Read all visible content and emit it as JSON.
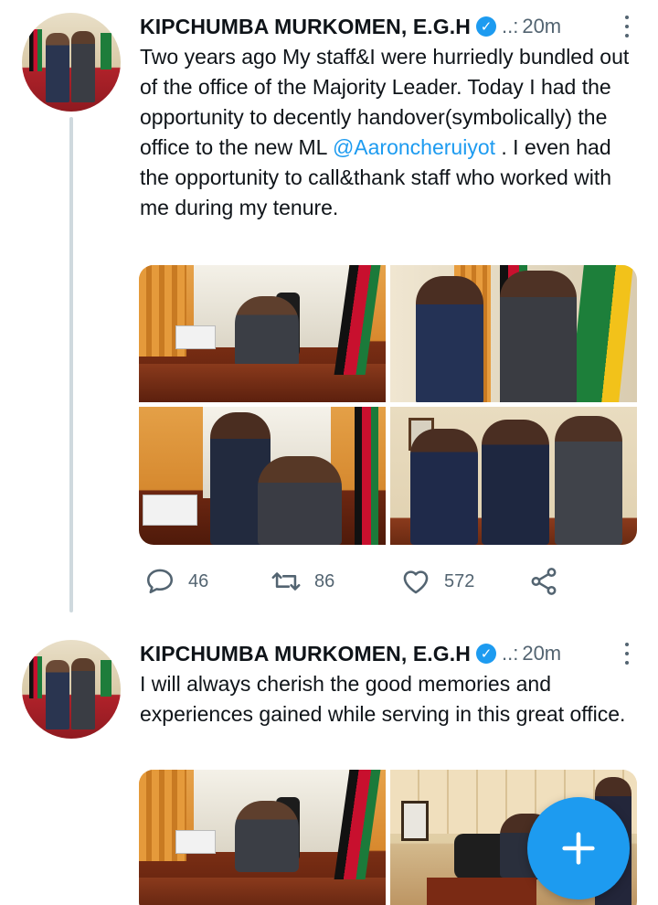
{
  "tweets": [
    {
      "author_name": "KIPCHUMBA MURKOMEN, E.G.H",
      "verified_icon": "verified-badge",
      "handle": "..:",
      "time": "20m",
      "text_before": "Two years ago My staff&I were hurriedly bundled out of the office of the Majority Leader. Today I had the opportunity to decently handover(symbolically)  the office to the new ML ",
      "mention": "@Aaroncheruiyot",
      "text_after": " . I even had the opportunity to call&thank staff who worked with me during my tenure.",
      "reply_count": "46",
      "retweet_count": "86",
      "like_count": "572"
    },
    {
      "author_name": "KIPCHUMBA MURKOMEN, E.G.H",
      "verified_icon": "verified-badge",
      "handle": "..:",
      "time": "20m",
      "text": "I will always cherish the good memories and experiences gained while serving in this great office."
    }
  ],
  "icons": {
    "reply": "reply-icon",
    "retweet": "retweet-icon",
    "like": "heart-icon",
    "share": "share-icon",
    "more": "more-vertical-icon",
    "compose": "plus-icon"
  },
  "colors": {
    "accent": "#1d9bf0",
    "secondary_text": "#536471",
    "thread_line": "#cfd9de"
  }
}
